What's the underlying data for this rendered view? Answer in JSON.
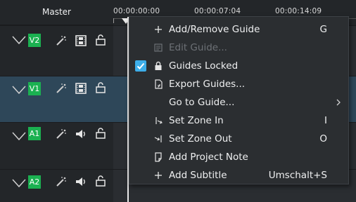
{
  "header": {
    "master_label": "Master"
  },
  "ruler": {
    "timecodes": [
      "00:00:00:00",
      "00:00:07:04",
      "00:00:14:09"
    ]
  },
  "tracks": [
    {
      "name": "V2",
      "kind": "video",
      "selected": false
    },
    {
      "name": "V1",
      "kind": "video",
      "selected": true
    },
    {
      "name": "A1",
      "kind": "audio",
      "selected": false
    },
    {
      "name": "A2",
      "kind": "audio",
      "selected": false
    }
  ],
  "menu": {
    "items": [
      {
        "label": "Add/Remove Guide",
        "shortcut": "G",
        "icon": "plus-icon",
        "enabled": true
      },
      {
        "label": "Edit Guide...",
        "shortcut": "",
        "icon": "edit-guide-icon",
        "enabled": false
      },
      {
        "label": "Guides Locked",
        "shortcut": "",
        "icon": "lock-icon",
        "enabled": true,
        "checked": true
      },
      {
        "label": "Export Guides...",
        "shortcut": "",
        "icon": "export-icon",
        "enabled": true
      },
      {
        "label": "Go to Guide...",
        "shortcut": "",
        "icon": "",
        "enabled": true,
        "submenu": true
      },
      {
        "label": "Set Zone In",
        "shortcut": "I",
        "icon": "zone-in-icon",
        "enabled": true
      },
      {
        "label": "Set Zone Out",
        "shortcut": "O",
        "icon": "zone-out-icon",
        "enabled": true
      },
      {
        "label": "Add Project Note",
        "shortcut": "",
        "icon": "note-icon",
        "enabled": true
      },
      {
        "label": "Add Subtitle",
        "shortcut": "Umschalt+S",
        "icon": "plus-icon",
        "enabled": true
      }
    ]
  },
  "colors": {
    "track_tag": "#1bb151",
    "selection": "#2e4759",
    "accent": "#3daee9"
  }
}
